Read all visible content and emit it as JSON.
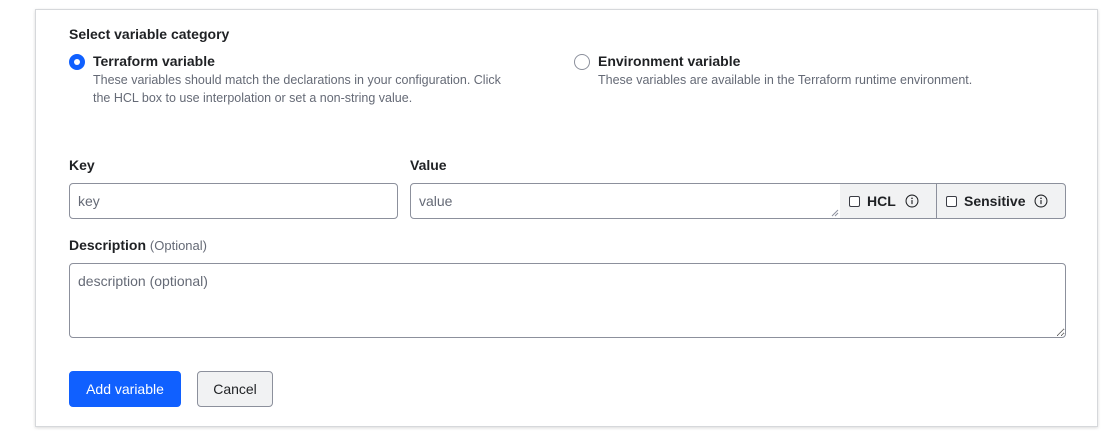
{
  "category": {
    "title": "Select variable category",
    "options": [
      {
        "label": "Terraform variable",
        "help_line1": "These variables should match the declarations in your configuration. Click",
        "help_line2": "the HCL box to use interpolation or set a non-string value.",
        "selected": true
      },
      {
        "label": "Environment variable",
        "help_line1": "These variables are available in the Terraform runtime environment.",
        "selected": false
      }
    ]
  },
  "key": {
    "label": "Key",
    "placeholder": "key",
    "value": ""
  },
  "value": {
    "label": "Value",
    "placeholder": "value",
    "value": "",
    "hcl_label": "HCL",
    "hcl_checked": false,
    "sensitive_label": "Sensitive",
    "sensitive_checked": false
  },
  "description": {
    "label": "Description",
    "optional_label": "(Optional)",
    "placeholder": "description (optional)",
    "value": ""
  },
  "actions": {
    "add_label": "Add variable",
    "cancel_label": "Cancel"
  },
  "colors": {
    "primary": "#1060ff",
    "border": "#8c909c",
    "addon_bg": "#f1f2f3",
    "muted_text": "#656a76"
  },
  "icons": {
    "hcl_info": "info-circle-icon",
    "sensitive_info": "info-circle-icon"
  }
}
